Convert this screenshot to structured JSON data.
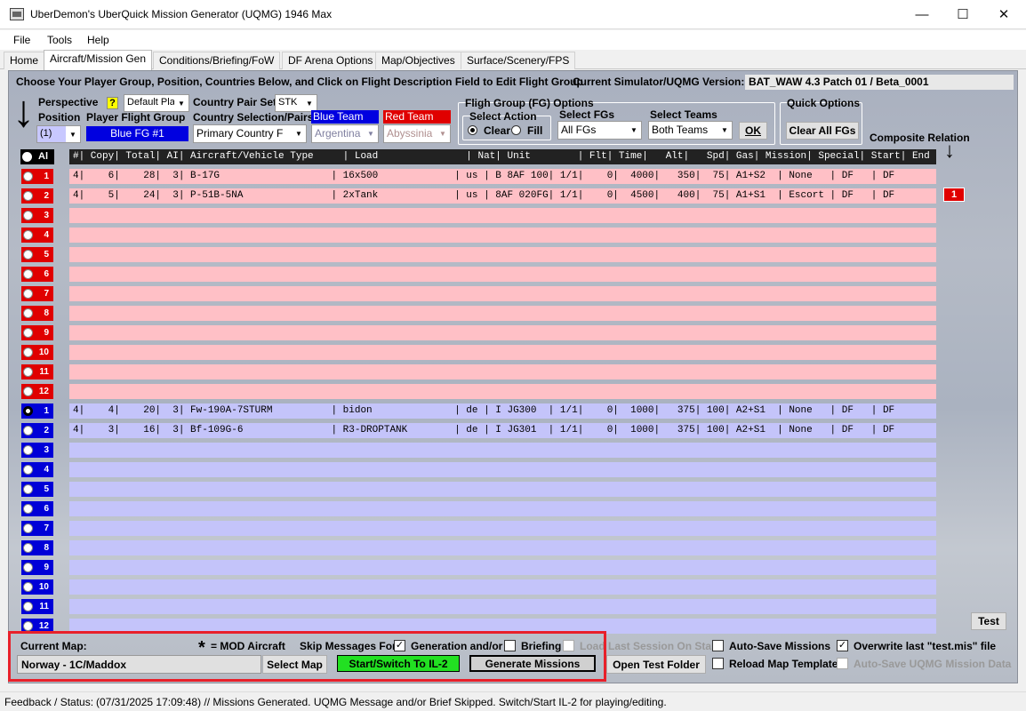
{
  "window": {
    "title": "UberDemon's UberQuick Mission Generator (UQMG) 1946 Max",
    "minimize": "—",
    "maximize": "☐",
    "close": "✕"
  },
  "menu": [
    "File",
    "Tools",
    "Help"
  ],
  "tabs": [
    "Home",
    "Aircraft/Mission Gen",
    "Conditions/Briefing/FoW",
    "DF Arena Options",
    "Map/Objectives",
    "Surface/Scenery/FPS"
  ],
  "instructions": "Choose Your Player Group, Position, Countries Below, and Click on Flight Description Field to Edit Flight Group",
  "version": {
    "label": "Current Simulator/UQMG Version:",
    "value": "BAT_WAW 4.3 Patch 01 / Beta_0001"
  },
  "perspective": {
    "label": "Perspective",
    "help": "?",
    "value": "Default Play"
  },
  "position": {
    "label": "Position",
    "value": "(1)"
  },
  "player_flight_group": {
    "label": "Player Flight Group",
    "value": "Blue FG #1"
  },
  "country_pair_set": {
    "label": "Country Pair Set",
    "value": "STK"
  },
  "country_selection": {
    "label": "Country Selection/Pairs",
    "value": "Primary Country F"
  },
  "blue_team": {
    "label": "Blue Team",
    "value": "Argentina"
  },
  "red_team": {
    "label": "Red Team",
    "value": "Abyssinia"
  },
  "fg_options": {
    "title": "Fligh Group (FG) Options",
    "select_action": "Select Action",
    "clear": "Clear",
    "fill": "Fill",
    "select_fgs": "Select FGs",
    "fgs_value": "All FGs",
    "select_teams": "Select Teams",
    "teams_value": "Both Teams",
    "ok": "OK"
  },
  "quick_options": {
    "title": "Quick Options",
    "clear_all": "Clear All FGs"
  },
  "composite": {
    "label": "Composite Relation",
    "arrow": "↓",
    "badge": "1"
  },
  "big_arrow": "↓",
  "all_label": "Al",
  "header": "#| Copy| Total| AI| Aircraft/Vehicle Type     | Load               | Nat| Unit        | Flt| Time|   Alt|   Spd| Gas| Mission| Special| Start| End",
  "red_rows": [
    "4|    6|    28|  3| B-17G                   | 16x500             | us | B 8AF 100| 1/1|    0|  4000|   350|  75| A1+S2  | None   | DF   | DF",
    "4|    5|    24|  3| P-51B-5NA               | 2xTank             | us | 8AF 020FG| 1/1|    0|  4500|   400|  75| A1+S1  | Escort | DF   | DF",
    "",
    "",
    "",
    "",
    "",
    "",
    "",
    "",
    "",
    ""
  ],
  "blue_rows": [
    "4|    4|    20|  3| Fw-190A-7STURM          | bidon              | de | I JG300  | 1/1|    0|  1000|   375| 100| A2+S1  | None   | DF   | DF",
    "4|    3|    16|  3| Bf-109G-6               | R3-DROPTANK        | de | I JG301  | 1/1|    0|  1000|   375| 100| A2+S1  | None   | DF   | DF",
    "",
    "",
    "",
    "",
    "",
    "",
    "",
    "",
    "",
    ""
  ],
  "row_numbers": [
    "1",
    "2",
    "3",
    "4",
    "5",
    "6",
    "7",
    "8",
    "9",
    "10",
    "11",
    "12"
  ],
  "test_button": "Test",
  "bottom": {
    "current_map_label": "Current Map:",
    "map_value": "Norway - 1C/Maddox",
    "select_map": "Select Map",
    "star": "*",
    "mod_aircraft": "= MOD Aircraft",
    "skip_messages": "Skip Messages For:",
    "generation": "Generation and/or",
    "briefing": "Briefing",
    "start_switch": "Start/Switch To IL-2",
    "generate": "Generate Missions",
    "load_last": "Load Last Session On Start",
    "auto_save": "Auto-Save Missions",
    "overwrite": "Overwrite last \"test.mis\" file",
    "open_test_folder": "Open Test Folder",
    "reload_map": "Reload Map Template",
    "auto_save_data": "Auto-Save UQMG Mission Data",
    "check": "✓"
  },
  "status": {
    "label": "Feedback / Status:",
    "text": "(07/31/2025 17:09:48) // Missions Generated.  UQMG Message and/or Brief Skipped.  Switch/Start IL-2 for playing/editing."
  },
  "colors": {
    "red_row": "#ffc0c6",
    "blue_row": "#c4c4fa",
    "red_btn": "#e00000",
    "blue_btn": "#0000d8",
    "start_btn": "#22e022",
    "highlight_box": "#e8202a"
  }
}
